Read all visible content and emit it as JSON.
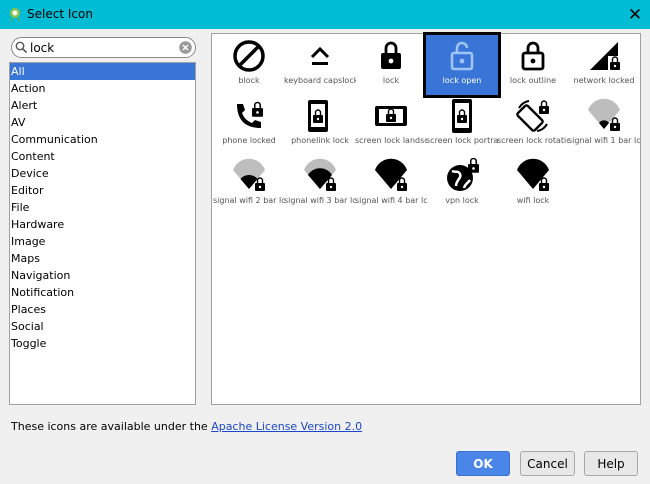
{
  "window": {
    "title": "Select Icon"
  },
  "search": {
    "value": "lock",
    "placeholder": ""
  },
  "categories": [
    "All",
    "Action",
    "Alert",
    "AV",
    "Communication",
    "Content",
    "Device",
    "Editor",
    "File",
    "Hardware",
    "Image",
    "Maps",
    "Navigation",
    "Notification",
    "Places",
    "Social",
    "Toggle"
  ],
  "selected_category": "All",
  "icons": [
    {
      "label": "block",
      "icon": "block-icon"
    },
    {
      "label": "keyboard capslock",
      "icon": "keyboard-capslock-icon"
    },
    {
      "label": "lock",
      "icon": "lock-icon"
    },
    {
      "label": "lock open",
      "icon": "lock-open-icon"
    },
    {
      "label": "lock outline",
      "icon": "lock-outline-icon"
    },
    {
      "label": "network locked",
      "icon": "network-locked-icon"
    },
    {
      "label": "phone locked",
      "icon": "phone-locked-icon"
    },
    {
      "label": "phonelink lock",
      "icon": "phonelink-lock-icon"
    },
    {
      "label": "screen lock landsc",
      "icon": "screen-lock-landscape-icon"
    },
    {
      "label": "screen lock portra",
      "icon": "screen-lock-portrait-icon"
    },
    {
      "label": "screen lock rotatic",
      "icon": "screen-lock-rotation-icon"
    },
    {
      "label": "signal wifi 1 bar lc",
      "icon": "signal-wifi-1-bar-lock-icon"
    },
    {
      "label": "signal wifi 2 bar lc",
      "icon": "signal-wifi-2-bar-lock-icon"
    },
    {
      "label": "signal wifi 3 bar lc",
      "icon": "signal-wifi-3-bar-lock-icon"
    },
    {
      "label": "signal wifi 4 bar lc",
      "icon": "signal-wifi-4-bar-lock-icon"
    },
    {
      "label": "vpn lock",
      "icon": "vpn-lock-icon"
    },
    {
      "label": "wifi lock",
      "icon": "wifi-lock-icon"
    }
  ],
  "selected_icon": "lock open",
  "footer": {
    "text": "These icons are available under the ",
    "link": "Apache License Version 2.0"
  },
  "buttons": {
    "ok": "OK",
    "cancel": "Cancel",
    "help": "Help"
  },
  "colors": {
    "titlebar": "#00bcd4",
    "selection": "#3875d7",
    "ok_button": "#4a86e8",
    "link": "#1a47c8"
  }
}
